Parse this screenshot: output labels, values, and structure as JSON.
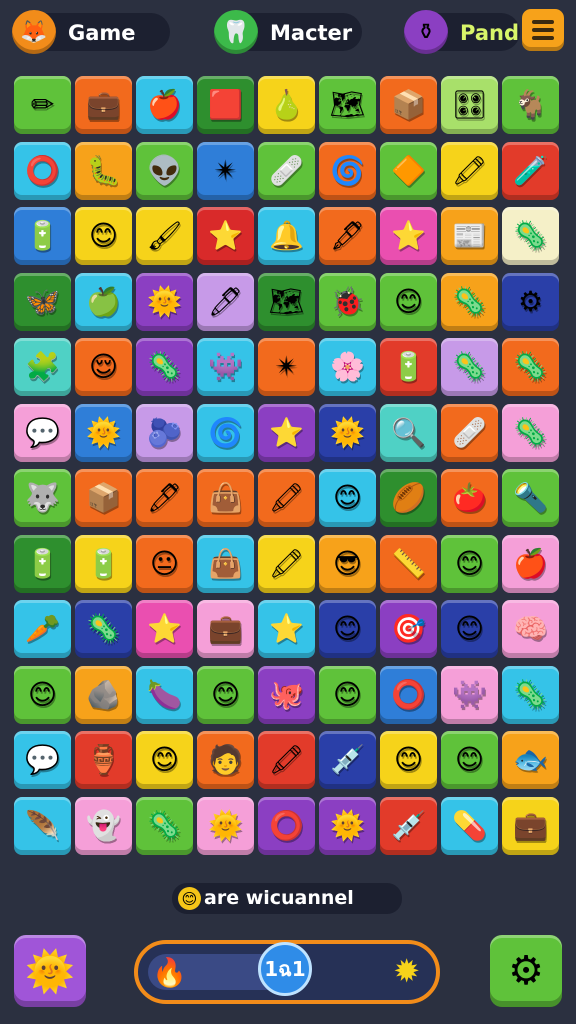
{
  "header": {
    "chips": [
      {
        "label": "Game",
        "icon": "fox-icon",
        "glyph": "🦊",
        "badge_color": "#f28c1a",
        "text_color": "#ffffff"
      },
      {
        "label": "Macter",
        "icon": "tooth-icon",
        "glyph": "🦷",
        "badge_color": "#3cba4a",
        "text_color": "#ffffff"
      },
      {
        "label": "Pand",
        "icon": "potion-icon",
        "glyph": "⚱",
        "badge_color": "#8b3fc2",
        "text_color": "#d8f56a"
      }
    ],
    "menu_icon": "hamburger-menu-icon"
  },
  "board": {
    "columns": 9,
    "rows": 12,
    "tiles": [
      [
        {
          "c": "#5fc23a",
          "g": "✏"
        },
        {
          "c": "#f26a1d",
          "g": "💼"
        },
        {
          "c": "#35c3e8",
          "g": "🍎"
        },
        {
          "c": "#2e8f2e",
          "g": "🟥"
        },
        {
          "c": "#f6d31a",
          "g": "🍐"
        },
        {
          "c": "#5fc23a",
          "g": "🗺"
        },
        {
          "c": "#f26a1d",
          "g": "📦"
        },
        {
          "c": "#a8e06a",
          "g": "🎛"
        },
        {
          "c": "#5fc23a",
          "g": "🐐"
        }
      ],
      [
        {
          "c": "#35c3e8",
          "g": "⭕"
        },
        {
          "c": "#f7a21a",
          "g": "🐛"
        },
        {
          "c": "#5fc23a",
          "g": "👽"
        },
        {
          "c": "#2f7ed8",
          "g": "✴"
        },
        {
          "c": "#5fc23a",
          "g": "🩹"
        },
        {
          "c": "#f26a1d",
          "g": "🌀"
        },
        {
          "c": "#5fc23a",
          "g": "🔶"
        },
        {
          "c": "#f6d31a",
          "g": "🖍"
        },
        {
          "c": "#e23b2a",
          "g": "🧪"
        }
      ],
      [
        {
          "c": "#2f7ed8",
          "g": "🔋"
        },
        {
          "c": "#f6d31a",
          "g": "😊"
        },
        {
          "c": "#f6d31a",
          "g": "🖌"
        },
        {
          "c": "#d92a2a",
          "g": "⭐"
        },
        {
          "c": "#35c3e8",
          "g": "🔔"
        },
        {
          "c": "#f26a1d",
          "g": "🖋"
        },
        {
          "c": "#ea4fb0",
          "g": "⭐"
        },
        {
          "c": "#f7a21a",
          "g": "📰"
        },
        {
          "c": "#f5f0c8",
          "g": "🦠"
        }
      ],
      [
        {
          "c": "#2e8f2e",
          "g": "🦋"
        },
        {
          "c": "#35c3e8",
          "g": "🍏"
        },
        {
          "c": "#8b3fc2",
          "g": "🌞"
        },
        {
          "c": "#c79ae8",
          "g": "🖊"
        },
        {
          "c": "#2e8f2e",
          "g": "🗺"
        },
        {
          "c": "#5fc23a",
          "g": "🐞"
        },
        {
          "c": "#5fc23a",
          "g": "😊"
        },
        {
          "c": "#f7a21a",
          "g": "🦠"
        },
        {
          "c": "#2a3fa8",
          "g": "⚙"
        }
      ],
      [
        {
          "c": "#4fd1c5",
          "g": "🧩"
        },
        {
          "c": "#f26a1d",
          "g": "😌"
        },
        {
          "c": "#8b3fc2",
          "g": "🦠"
        },
        {
          "c": "#35c3e8",
          "g": "👾"
        },
        {
          "c": "#f26a1d",
          "g": "✴"
        },
        {
          "c": "#35c3e8",
          "g": "🌸"
        },
        {
          "c": "#e23b2a",
          "g": "🔋"
        },
        {
          "c": "#c79ae8",
          "g": "🦠"
        },
        {
          "c": "#f26a1d",
          "g": "🦠"
        }
      ],
      [
        {
          "c": "#f59fd8",
          "g": "💬"
        },
        {
          "c": "#2f7ed8",
          "g": "🌞"
        },
        {
          "c": "#c79ae8",
          "g": "🫐"
        },
        {
          "c": "#35c3e8",
          "g": "🌀"
        },
        {
          "c": "#8b3fc2",
          "g": "⭐"
        },
        {
          "c": "#2a3fa8",
          "g": "🌞"
        },
        {
          "c": "#4fd1c5",
          "g": "🔍"
        },
        {
          "c": "#f26a1d",
          "g": "🩹"
        },
        {
          "c": "#f59fd8",
          "g": "🦠"
        }
      ],
      [
        {
          "c": "#5fc23a",
          "g": "🐺"
        },
        {
          "c": "#f26a1d",
          "g": "📦"
        },
        {
          "c": "#f26a1d",
          "g": "🖊"
        },
        {
          "c": "#f26a1d",
          "g": "👜"
        },
        {
          "c": "#f26a1d",
          "g": "🖍"
        },
        {
          "c": "#35c3e8",
          "g": "😊"
        },
        {
          "c": "#2e8f2e",
          "g": "🏉"
        },
        {
          "c": "#f26a1d",
          "g": "🍅"
        },
        {
          "c": "#5fc23a",
          "g": "🔦"
        }
      ],
      [
        {
          "c": "#2e8f2e",
          "g": "🔋"
        },
        {
          "c": "#f6d31a",
          "g": "🔋"
        },
        {
          "c": "#f26a1d",
          "g": "😐"
        },
        {
          "c": "#35c3e8",
          "g": "👜"
        },
        {
          "c": "#f6d31a",
          "g": "🖍"
        },
        {
          "c": "#f7a21a",
          "g": "😎"
        },
        {
          "c": "#f26a1d",
          "g": "📏"
        },
        {
          "c": "#5fc23a",
          "g": "😊"
        },
        {
          "c": "#f59fd8",
          "g": "🍎"
        }
      ],
      [
        {
          "c": "#35c3e8",
          "g": "🥕"
        },
        {
          "c": "#2a3fa8",
          "g": "🦠"
        },
        {
          "c": "#ea4fb0",
          "g": "⭐"
        },
        {
          "c": "#f59fd8",
          "g": "💼"
        },
        {
          "c": "#35c3e8",
          "g": "⭐"
        },
        {
          "c": "#2a3fa8",
          "g": "😊"
        },
        {
          "c": "#8b3fc2",
          "g": "🎯"
        },
        {
          "c": "#2a3fa8",
          "g": "😊"
        },
        {
          "c": "#f59fd8",
          "g": "🧠"
        }
      ],
      [
        {
          "c": "#5fc23a",
          "g": "😊"
        },
        {
          "c": "#f7a21a",
          "g": "🪨"
        },
        {
          "c": "#35c3e8",
          "g": "🍆"
        },
        {
          "c": "#5fc23a",
          "g": "😊"
        },
        {
          "c": "#8b3fc2",
          "g": "🐙"
        },
        {
          "c": "#5fc23a",
          "g": "😊"
        },
        {
          "c": "#2f7ed8",
          "g": "⭕"
        },
        {
          "c": "#f59fd8",
          "g": "👾"
        },
        {
          "c": "#35c3e8",
          "g": "🦠"
        }
      ],
      [
        {
          "c": "#35c3e8",
          "g": "💬"
        },
        {
          "c": "#e23b2a",
          "g": "🏺"
        },
        {
          "c": "#f6d31a",
          "g": "😊"
        },
        {
          "c": "#f26a1d",
          "g": "🧑"
        },
        {
          "c": "#e23b2a",
          "g": "🖍"
        },
        {
          "c": "#2a3fa8",
          "g": "💉"
        },
        {
          "c": "#f6d31a",
          "g": "😊"
        },
        {
          "c": "#5fc23a",
          "g": "😊"
        },
        {
          "c": "#f7a21a",
          "g": "🐟"
        }
      ],
      [
        {
          "c": "#35c3e8",
          "g": "🪶"
        },
        {
          "c": "#f59fd8",
          "g": "👻"
        },
        {
          "c": "#5fc23a",
          "g": "🦠"
        },
        {
          "c": "#f59fd8",
          "g": "🌞"
        },
        {
          "c": "#8b3fc2",
          "g": "⭕"
        },
        {
          "c": "#8b3fc2",
          "g": "🌞"
        },
        {
          "c": "#e23b2a",
          "g": "💉"
        },
        {
          "c": "#35c3e8",
          "g": "💊"
        },
        {
          "c": "#f6d31a",
          "g": "💼"
        }
      ]
    ]
  },
  "status": {
    "text": "are wicuannel",
    "icon": "smiley-icon",
    "glyph": "😊"
  },
  "footer": {
    "left_button": {
      "icon": "sun-icon",
      "glyph": "🌞",
      "color": "#a055d8"
    },
    "right_button": {
      "icon": "gear-icon",
      "glyph": "⚙",
      "color": "#5fc23a"
    },
    "progress": {
      "value": 0.5,
      "left_icon": "flame-icon",
      "left_glyph": "🔥",
      "right_icon": "sun-icon",
      "right_glyph": "✹"
    },
    "score": "1ฉ1"
  }
}
